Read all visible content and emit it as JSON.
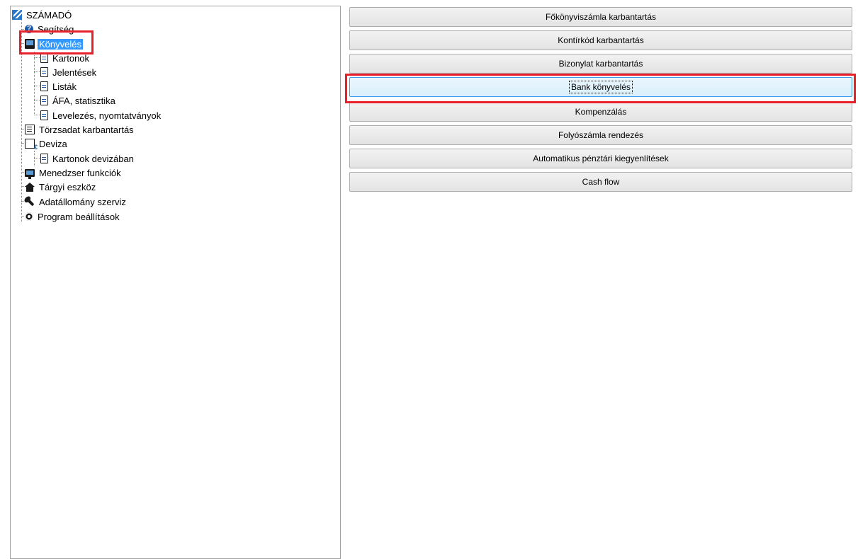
{
  "tree": {
    "root": "SZÁMADÓ",
    "items": [
      {
        "label": "Segítség",
        "icon": "help-icon"
      },
      {
        "label": "Könyvelés",
        "icon": "book-icon",
        "selected": true
      },
      {
        "label": "Kartonok",
        "icon": "document-icon"
      },
      {
        "label": "Jelentések",
        "icon": "document-icon"
      },
      {
        "label": "Listák",
        "icon": "document-icon"
      },
      {
        "label": "ÁFA, statisztika",
        "icon": "document-icon"
      },
      {
        "label": "Levelezés, nyomtatványok",
        "icon": "document-icon"
      },
      {
        "label": "Törzsadat karbantartás",
        "icon": "table-icon"
      },
      {
        "label": "Deviza",
        "icon": "currency-icon"
      },
      {
        "label": "Kartonok devizában",
        "icon": "document-icon"
      },
      {
        "label": "Menedzser funkciók",
        "icon": "monitor-icon"
      },
      {
        "label": "Tárgyi eszköz",
        "icon": "house-icon"
      },
      {
        "label": "Adatállomány szerviz",
        "icon": "wrench-icon"
      },
      {
        "label": "Program beállítások",
        "icon": "gear-icon"
      }
    ]
  },
  "buttons": [
    {
      "label": "Főkönyviszámla karbantartás"
    },
    {
      "label": "Kontírkód karbantartás"
    },
    {
      "label": "Bizonylat karbantartás"
    },
    {
      "label": "Bank könyvelés",
      "focused": true
    },
    {
      "label": "Kompenzálás"
    },
    {
      "label": "Folyószámla rendezés"
    },
    {
      "label": "Automatikus pénztári kiegyenlítések"
    },
    {
      "label": "Cash flow"
    }
  ],
  "colors": {
    "selection": "#3399ff",
    "highlight": "#e8202a",
    "focus_border": "#3c9be8"
  }
}
